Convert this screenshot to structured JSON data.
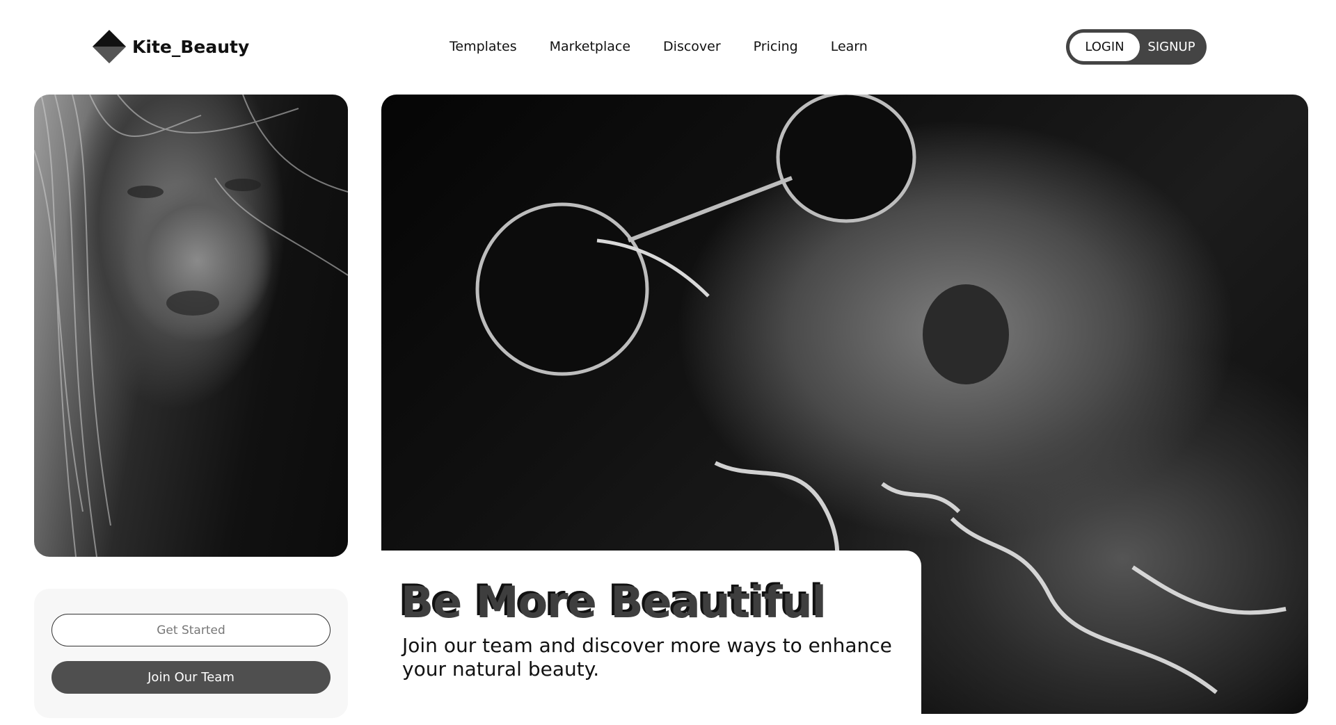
{
  "brand": {
    "name": "Kite_Beauty",
    "logo_icon": "diamond-logo-icon"
  },
  "nav": {
    "items": [
      {
        "label": "Templates"
      },
      {
        "label": "Marketplace"
      },
      {
        "label": "Discover"
      },
      {
        "label": "Pricing"
      },
      {
        "label": "Learn"
      }
    ]
  },
  "auth": {
    "login_label": "LOGIN",
    "signup_label": "SIGNUP"
  },
  "hero": {
    "title": "Be More Beautiful",
    "subtitle": "Join our team and discover more ways to enhance your natural beauty."
  },
  "cta": {
    "get_started_label": "Get Started",
    "join_label": "Join Our Team"
  },
  "colors": {
    "background": "#ffffff",
    "accent_dark": "#444444",
    "button_dark": "#4f4f4f",
    "text": "#111111"
  }
}
